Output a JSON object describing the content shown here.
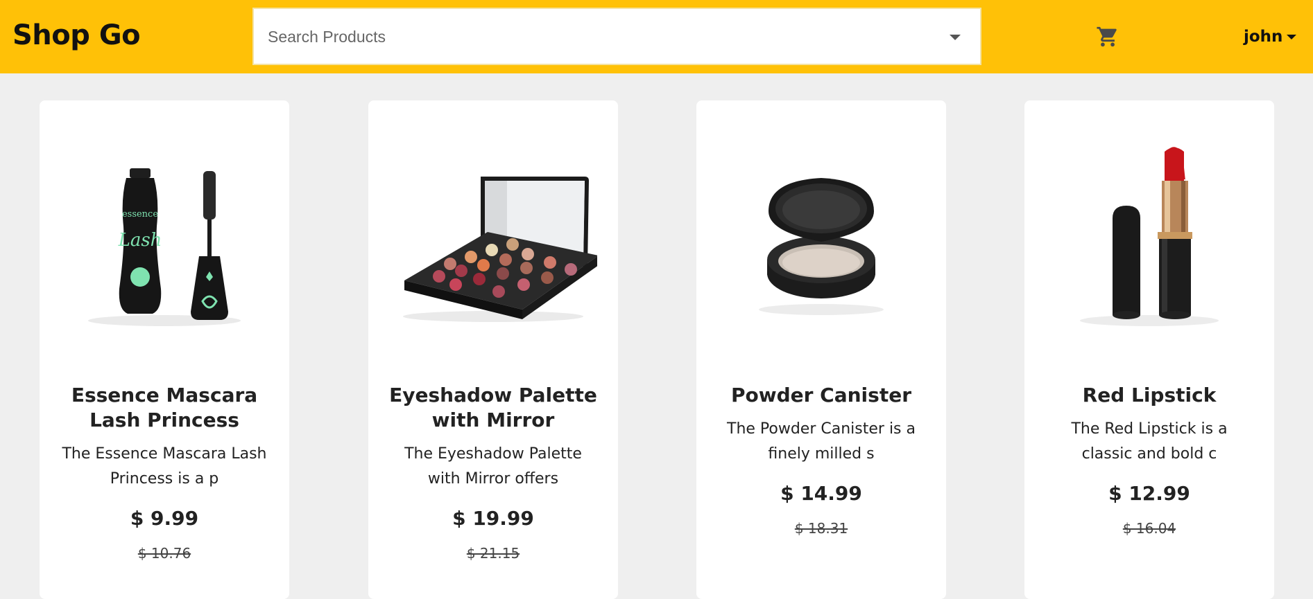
{
  "header": {
    "brand": "Shop Go",
    "search_placeholder": "Search Products",
    "user_name": "john"
  },
  "products": [
    {
      "title": "Essence Mascara Lash Princess",
      "description": "The Essence Mascara Lash Princess is a p",
      "price": "$ 9.99",
      "original_price": "$ 10.76",
      "image_icon": "mascara-image"
    },
    {
      "title": "Eyeshadow Palette with Mirror",
      "description": "The Eyeshadow Palette with Mirror offers",
      "price": "$ 19.99",
      "original_price": "$ 21.15",
      "image_icon": "eyeshadow-palette-image"
    },
    {
      "title": "Powder Canister",
      "description": "The Powder Canister is a finely milled s",
      "price": "$ 14.99",
      "original_price": "$ 18.31",
      "image_icon": "powder-canister-image"
    },
    {
      "title": "Red Lipstick",
      "description": "The Red Lipstick is a classic and bold c",
      "price": "$ 12.99",
      "original_price": "$ 16.04",
      "image_icon": "lipstick-image"
    }
  ],
  "colors": {
    "navbar": "#ffc107",
    "background": "#efefef",
    "card": "#ffffff"
  }
}
